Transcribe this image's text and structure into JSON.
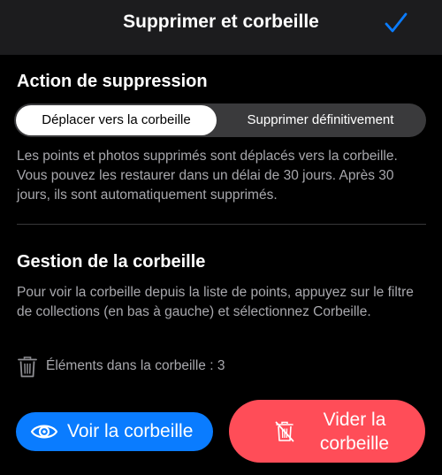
{
  "header": {
    "title": "Supprimer et corbeille",
    "confirm_icon": "checkmark-icon",
    "accent_color": "#0a7cff"
  },
  "deletion_action": {
    "title": "Action de suppression",
    "options": [
      {
        "label": "Déplacer vers la corbeille",
        "selected": true
      },
      {
        "label": "Supprimer définitivement",
        "selected": false
      }
    ],
    "description": "Les points et photos supprimés sont déplacés vers la corbeille. Vous pouvez les restaurer dans un délai de 30 jours. Après 30 jours, ils sont automatiquement supprimés."
  },
  "trash_management": {
    "title": "Gestion de la corbeille",
    "description": "Pour voir la corbeille depuis la liste de points, appuyez sur le filtre de collections (en bas à gauche) et sélectionnez Corbeille.",
    "items_label": "Éléments dans la corbeille : 3",
    "items_icon": "trash-icon"
  },
  "buttons": {
    "view_trash": {
      "label": "Voir la corbeille",
      "icon": "eye-icon",
      "color": "#0a7cff"
    },
    "empty_trash": {
      "label": "Vider la corbeille",
      "icon": "trash-slash-icon",
      "color": "#ff4d58"
    }
  }
}
